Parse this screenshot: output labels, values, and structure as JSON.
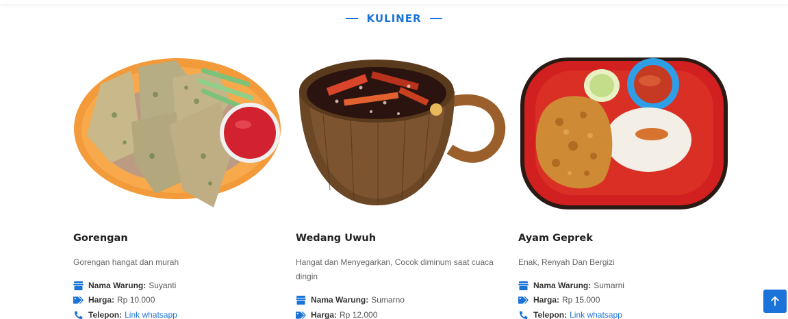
{
  "section": {
    "title": "KULINER"
  },
  "accent_color": "#1a73d9",
  "cards": [
    {
      "name": "Gorengan",
      "description": "Gorengan hangat dan murah",
      "warung_label": "Nama Warung:",
      "warung_value": "Suyanti",
      "harga_label": "Harga:",
      "harga_value": "Rp 10.000",
      "telepon_label": "Telepon:",
      "telepon_link": "Link whatsapp"
    },
    {
      "name": "Wedang Uwuh",
      "description": "Hangat dan Menyegarkan, Cocok diminum saat cuaca dingin",
      "warung_label": "Nama Warung:",
      "warung_value": "Sumarno",
      "harga_label": "Harga:",
      "harga_value": "Rp 12.000"
    },
    {
      "name": "Ayam Geprek",
      "description": "Enak, Renyah Dan Bergizi",
      "warung_label": "Nama Warung:",
      "warung_value": "Sumarni",
      "harga_label": "Harga:",
      "harga_value": "Rp 15.000",
      "telepon_label": "Telepon:",
      "telepon_link": "Link whatsapp"
    }
  ],
  "icons": {
    "warung": "store-icon",
    "harga": "tag-icon",
    "telepon": "phone-icon",
    "back_to_top": "arrow-up-icon"
  }
}
